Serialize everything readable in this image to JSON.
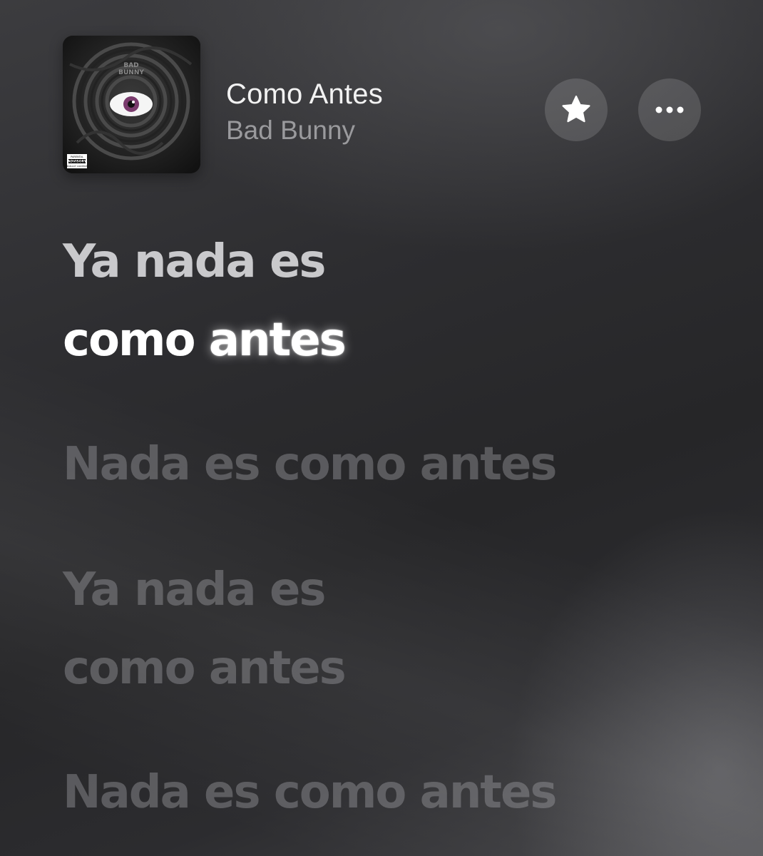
{
  "now_playing": {
    "title": "Como Antes",
    "artist": "Bad Bunny",
    "artwork_icon": "album-artwork-eye",
    "artwork_text": [
      "BAD BUNNY",
      "PARENTAL ADVISORY EXPLICIT CONTENT"
    ]
  },
  "actions": {
    "favorite_icon": "star-icon",
    "more_icon": "ellipsis-icon"
  },
  "lyrics": {
    "active": {
      "line1": "Ya nada es",
      "line2_sung": "como",
      "line2_current": "antes"
    },
    "upcoming": [
      {
        "lines": [
          "Nada es como antes"
        ]
      },
      {
        "lines": [
          "Ya nada es",
          "como antes"
        ]
      },
      {
        "lines": [
          "Nada es como antes"
        ]
      }
    ]
  },
  "colors": {
    "background": "#2a2a2d",
    "title": "#f2f2f2",
    "artist": "#9a9a9d",
    "lyric_active": "#ffffff",
    "lyric_inactive": "#6b6b6f"
  }
}
